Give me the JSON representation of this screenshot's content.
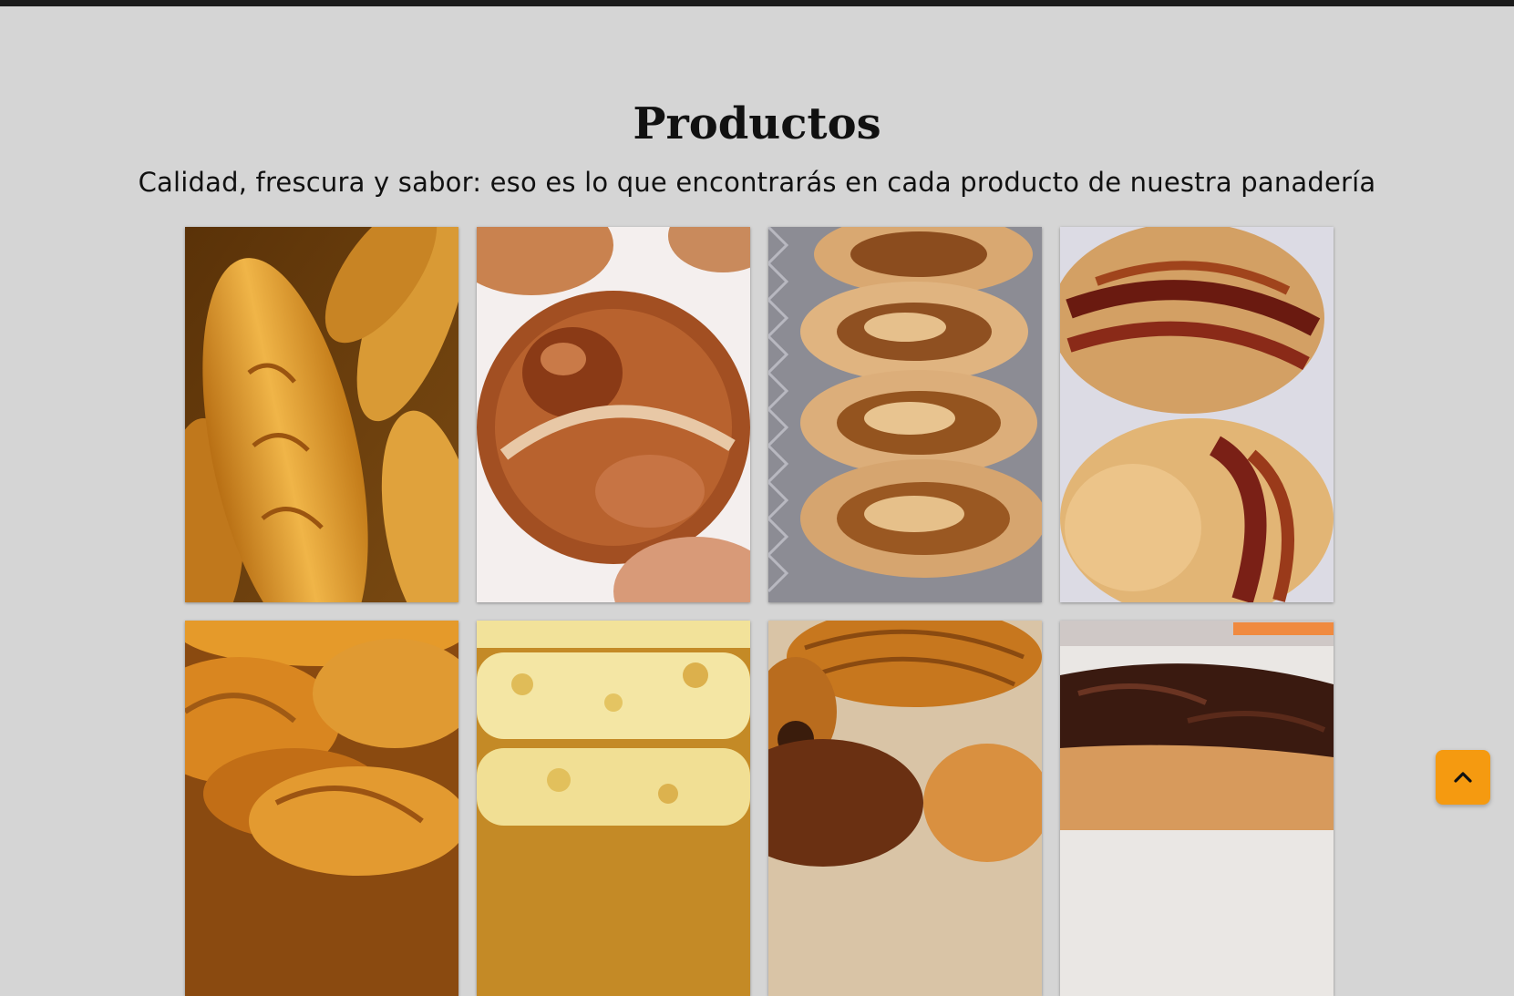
{
  "products_section": {
    "title": "Productos",
    "subtitle": "Calidad, frescura y sabor: eso es lo que encontrarás en cada producto de nuestra panadería"
  },
  "products": [
    {
      "icon": "baguette-photo"
    },
    {
      "icon": "sweet-bun-photo"
    },
    {
      "icon": "dulce-de-leche-roll-photo"
    },
    {
      "icon": "cinnamon-swirl-pastry-photo"
    },
    {
      "icon": "croissant-photo"
    },
    {
      "icon": "cheese-bread-stick-photo"
    },
    {
      "icon": "pain-au-chocolat-photo"
    },
    {
      "icon": "chocolate-eclair-photo"
    }
  ],
  "scroll_top_button": {
    "icon": "chevron-up-icon"
  },
  "colors": {
    "background": "#d5d5d5",
    "top_bar": "#1b1b1b",
    "accent": "#f59a10"
  }
}
